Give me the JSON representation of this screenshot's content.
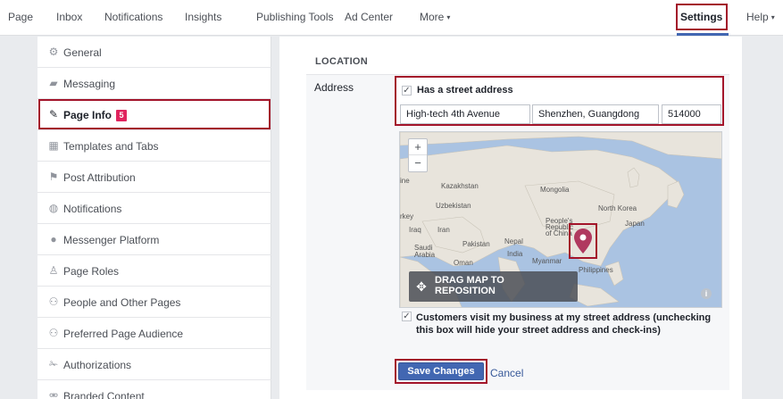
{
  "topnav": {
    "items": [
      "Page",
      "Inbox",
      "Notifications",
      "Insights",
      "Publishing Tools",
      "Ad Center",
      "More"
    ],
    "settings": "Settings",
    "help": "Help"
  },
  "sidebar": {
    "items": [
      {
        "label": "General",
        "icon": "gear-icon"
      },
      {
        "label": "Messaging",
        "icon": "chat-icon"
      },
      {
        "label": "Page Info",
        "icon": "pencil-icon",
        "badge": "5"
      },
      {
        "label": "Templates and Tabs",
        "icon": "grid-icon"
      },
      {
        "label": "Post Attribution",
        "icon": "flag-icon"
      },
      {
        "label": "Notifications",
        "icon": "globe-icon"
      },
      {
        "label": "Messenger Platform",
        "icon": "messenger-icon"
      },
      {
        "label": "Page Roles",
        "icon": "person-icon"
      },
      {
        "label": "People and Other Pages",
        "icon": "people-icon"
      },
      {
        "label": "Preferred Page Audience",
        "icon": "people-icon"
      },
      {
        "label": "Authorizations",
        "icon": "wrench-icon"
      },
      {
        "label": "Branded Content",
        "icon": "handshake-icon"
      }
    ]
  },
  "location": {
    "title": "LOCATION",
    "address_label": "Address",
    "has_street_label": "Has a street address",
    "street": "High-tech 4th Avenue",
    "city": "Shenzhen, Guangdong",
    "zip": "514000",
    "map_labels": [
      "Kazakhstan",
      "Mongolia",
      "Uzbekistan",
      "North Korea",
      "Japan",
      "rkey",
      "Iraq",
      "Iran",
      "People's Republic of China",
      "Saudi Arabia",
      "Pakistan",
      "Nepal",
      "India",
      "Oman",
      "Myanmar",
      "Philippines",
      "ine"
    ],
    "drag_text": "DRAG MAP TO REPOSITION",
    "customers_label": "Customers visit my business at my street address (unchecking this box will hide your street address and check-ins)",
    "save": "Save Changes",
    "cancel": "Cancel"
  },
  "colors": {
    "accent": "#4267b2",
    "highlight": "#a3142a",
    "badge": "#e0245e",
    "map_water": "#aac3e2",
    "map_land": "#e8e4dc"
  }
}
